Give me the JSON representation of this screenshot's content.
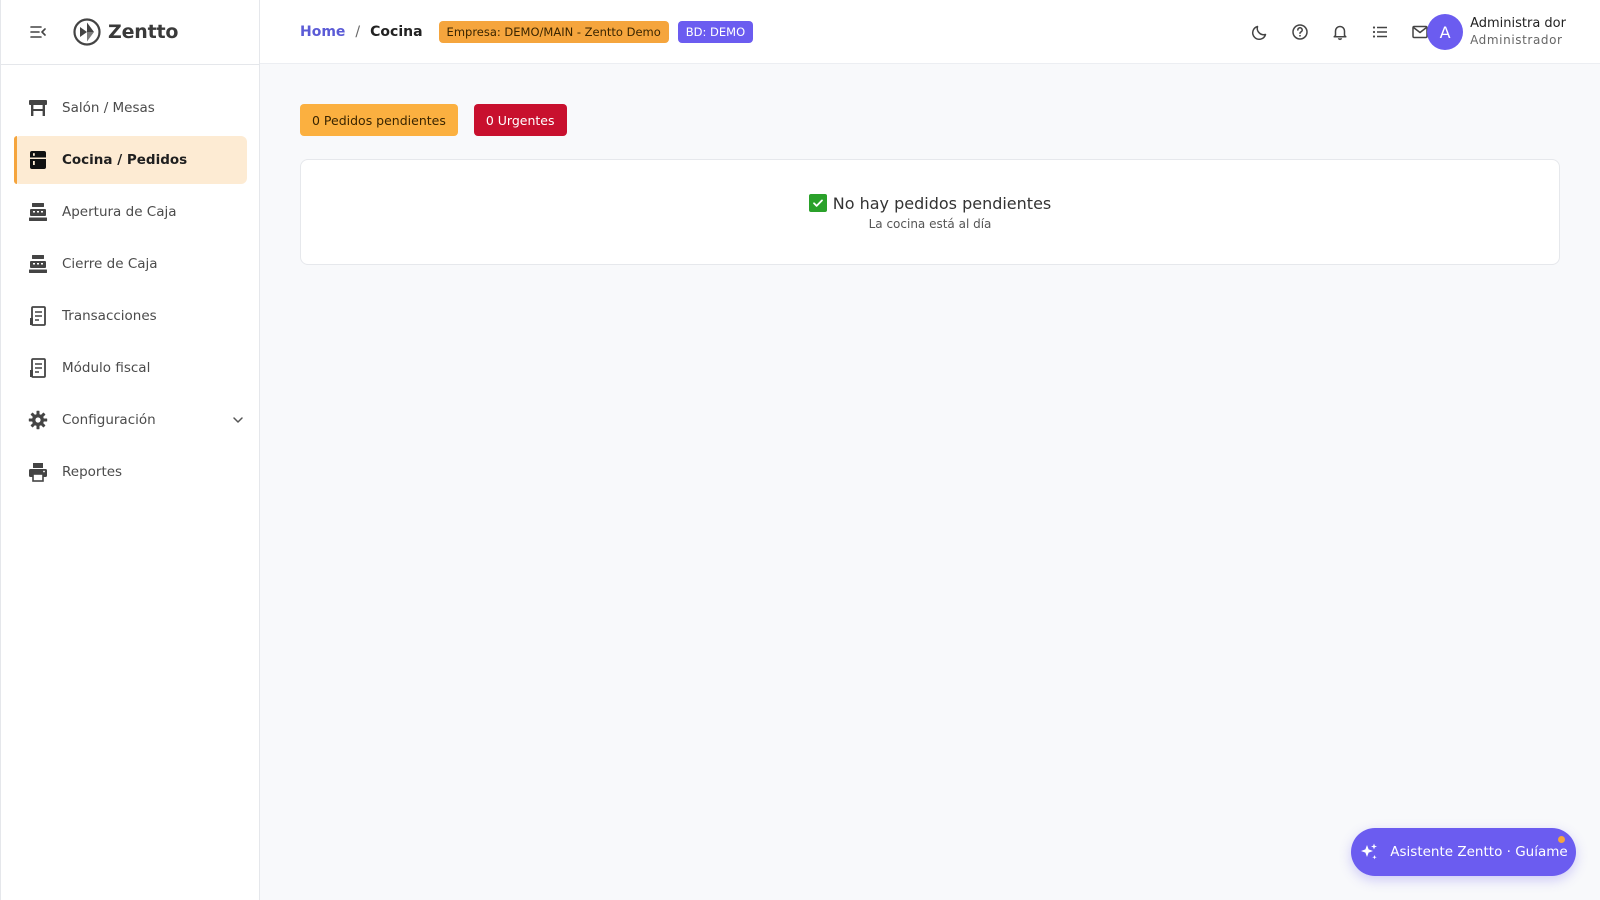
{
  "brand": {
    "name": "Zentto"
  },
  "sidebar": {
    "items": [
      {
        "label": "Salón / Mesas",
        "icon": "table-icon"
      },
      {
        "label": "Cocina / Pedidos",
        "icon": "kitchen-icon",
        "active": true
      },
      {
        "label": "Apertura de Caja",
        "icon": "cash-register-icon"
      },
      {
        "label": "Cierre de Caja",
        "icon": "cash-register-icon"
      },
      {
        "label": "Transacciones",
        "icon": "receipt-icon"
      },
      {
        "label": "Módulo fiscal",
        "icon": "receipt-icon"
      },
      {
        "label": "Configuración",
        "icon": "gear-icon",
        "expandable": true
      },
      {
        "label": "Reportes",
        "icon": "printer-icon"
      }
    ]
  },
  "header": {
    "breadcrumb": {
      "home": "Home",
      "separator": "/",
      "current": "Cocina"
    },
    "badges": {
      "empresa": "Empresa: DEMO/MAIN - Zentto Demo",
      "bd": "BD: DEMO"
    },
    "icons": [
      "moon-icon",
      "help-icon",
      "bell-icon",
      "list-icon",
      "mail-icon"
    ],
    "user": {
      "initial": "A",
      "name": "Administra dor",
      "role": "Administrador"
    }
  },
  "main": {
    "pending_label": "0 Pedidos pendientes",
    "urgent_label": "0 Urgentes",
    "empty_title": "No hay pedidos pendientes",
    "empty_subtitle": "La cocina está al día"
  },
  "assistant": {
    "label": "Asistente Zentto · Guíame"
  },
  "colors": {
    "accent": "#6b5cf0",
    "warning": "#f5a53d",
    "danger": "#c8102e",
    "active_bg": "#fdebd3"
  }
}
